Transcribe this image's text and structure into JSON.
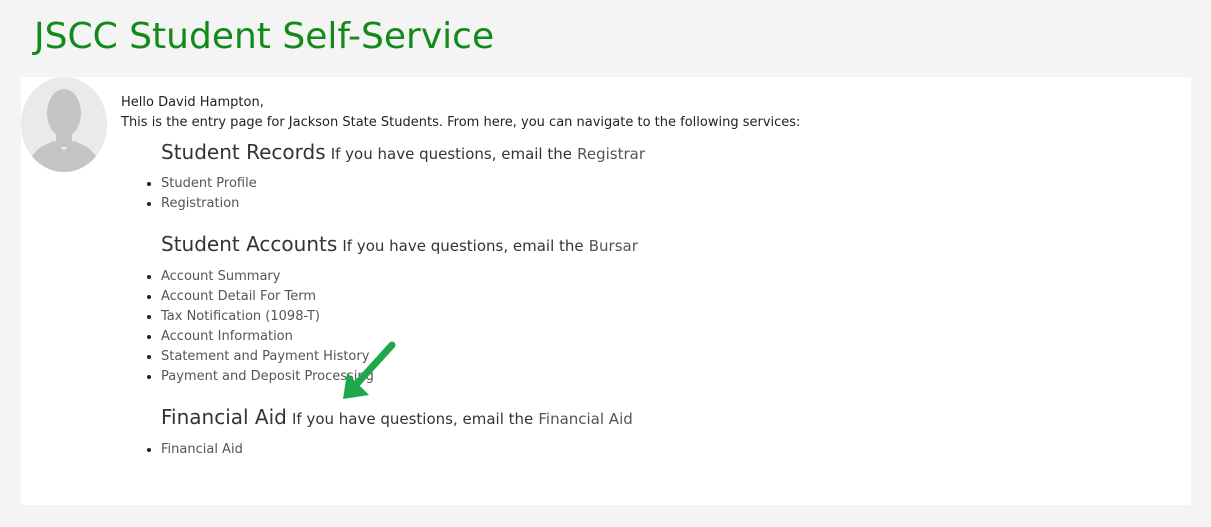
{
  "header": {
    "title": "JSCC Student Self-Service"
  },
  "intro": {
    "greeting": "Hello David Hampton,",
    "description": "This is the entry page for Jackson State Students. From here, you can navigate to the following services:"
  },
  "sections": [
    {
      "title": "Student Records",
      "contact_text": "If you have questions, email the",
      "contact_link": "Registrar",
      "items": [
        "Student Profile",
        "Registration"
      ]
    },
    {
      "title": "Student Accounts",
      "contact_text": "If you have questions, email the",
      "contact_link": "Bursar",
      "items": [
        "Account Summary",
        "Account Detail For Term",
        "Tax Notification (1098-T)",
        "Account Information",
        "Statement and Payment History",
        "Payment and Deposit Processing"
      ]
    },
    {
      "title": "Financial Aid",
      "contact_text": "If you have questions, email the",
      "contact_link": "Financial Aid",
      "items": [
        "Financial Aid"
      ]
    }
  ],
  "colors": {
    "title": "#118a1a",
    "arrow": "#1fa84a",
    "link": "#555555"
  },
  "icons": {
    "avatar": "user-silhouette-icon",
    "arrow": "annotation-arrow-icon"
  }
}
